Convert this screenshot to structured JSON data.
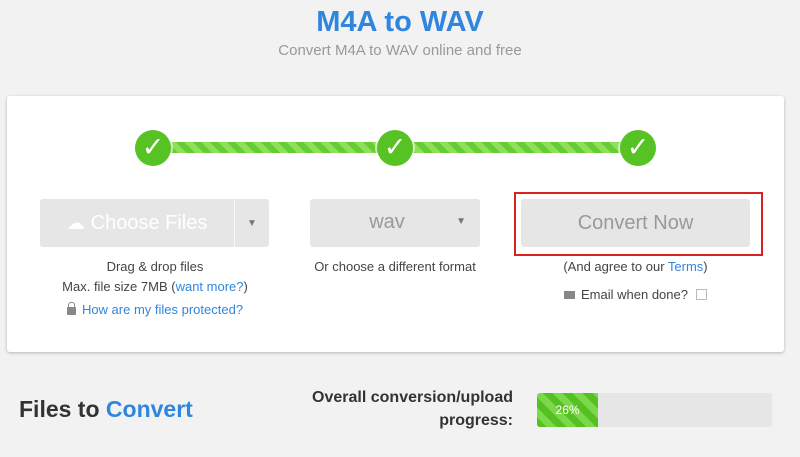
{
  "header": {
    "title": "M4A to WAV",
    "subtitle": "Convert M4A to WAV online and free"
  },
  "steps": [
    {
      "icon": "checkmark-icon",
      "glyph": "✓"
    },
    {
      "icon": "checkmark-icon",
      "glyph": "✓"
    },
    {
      "icon": "checkmark-icon",
      "glyph": "✓"
    }
  ],
  "upload": {
    "button_label": "Choose Files",
    "button_icon": "cloud-upload-icon",
    "dropdown_icon": "caret-down-icon",
    "drag_text": "Drag & drop files",
    "max_size_text": "Max. file size 7MB (",
    "want_more_link": "want more?",
    "max_size_close": ")",
    "protected_link": "How are my files protected?",
    "protected_icon": "lock-icon"
  },
  "format": {
    "selected": "wav",
    "caret_icon": "caret-down-icon",
    "hint": "Or choose a different format"
  },
  "convert": {
    "button_label": "Convert Now",
    "agree_prefix": "(And agree to our ",
    "terms_link": "Terms",
    "agree_suffix": ")",
    "email_icon": "envelope-icon",
    "email_label": "Email when done?",
    "email_checked": false,
    "highlight_color": "#d92222"
  },
  "files": {
    "title_prefix": "Files to ",
    "title_accent": "Convert"
  },
  "progress": {
    "label_line1": "Overall conversion/upload",
    "label_line2": "progress:",
    "value_text": "26%",
    "fraction": 0.26
  },
  "colors": {
    "accent": "#2f86de",
    "success": "#57c223"
  }
}
